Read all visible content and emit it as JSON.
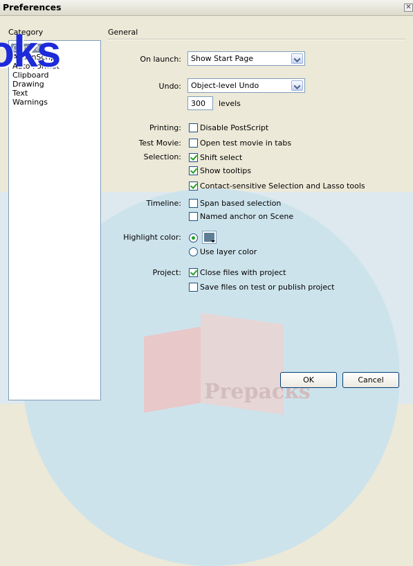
{
  "window": {
    "title": "Preferences",
    "close_glyph": "✕"
  },
  "watermark": {
    "logo_text": "oks",
    "bottom_text": "Prepacks"
  },
  "category": {
    "label": "Category",
    "items": [
      "General",
      "ActionScript",
      "Auto Format",
      "Clipboard",
      "Drawing",
      "Text",
      "Warnings"
    ],
    "selected": "General"
  },
  "section": {
    "title": "General"
  },
  "on_launch": {
    "label": "On launch:",
    "value": "Show Start Page"
  },
  "undo": {
    "label": "Undo:",
    "value": "Object-level Undo",
    "levels_value": "300",
    "levels_label": "levels"
  },
  "printing": {
    "label": "Printing:",
    "option": "Disable PostScript",
    "checked": false
  },
  "test_movie": {
    "label": "Test Movie:",
    "option": "Open test movie in tabs",
    "checked": false
  },
  "selection": {
    "label": "Selection:",
    "options": [
      {
        "text": "Shift select",
        "checked": true
      },
      {
        "text": "Show tooltips",
        "checked": true
      },
      {
        "text": "Contact-sensitive Selection and Lasso tools",
        "checked": true
      }
    ]
  },
  "timeline": {
    "label": "Timeline:",
    "options": [
      {
        "text": "Span based selection",
        "checked": false
      },
      {
        "text": "Named anchor on Scene",
        "checked": false
      }
    ]
  },
  "highlight": {
    "label": "Highlight color:",
    "alt_option": "Use layer color",
    "swatch_color": "#5e7e96"
  },
  "project": {
    "label": "Project:",
    "options": [
      {
        "text": "Close files with project",
        "checked": true
      },
      {
        "text": "Save files on test or publish project",
        "checked": false
      }
    ]
  },
  "buttons": {
    "ok": "OK",
    "cancel": "Cancel"
  }
}
